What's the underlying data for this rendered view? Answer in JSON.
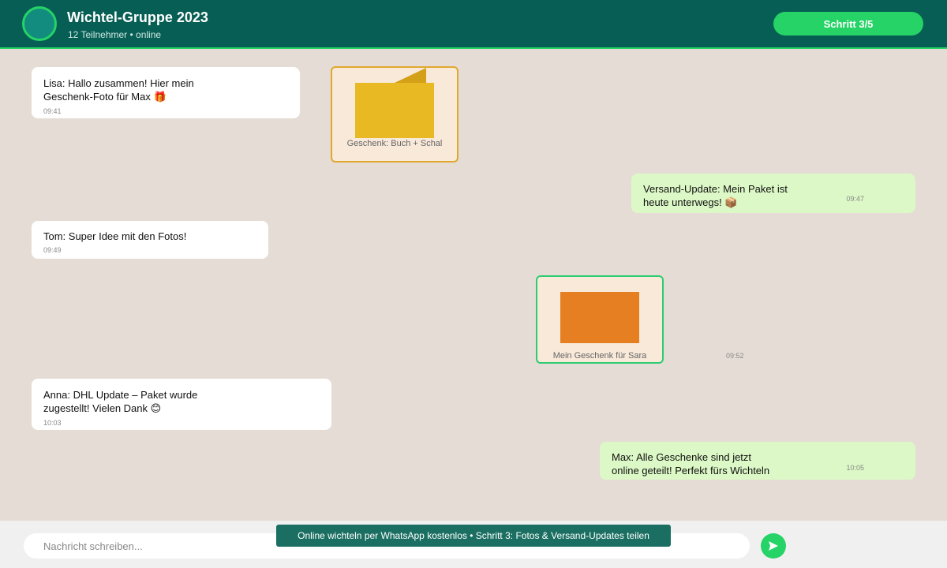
{
  "header": {
    "title": "Wichtel-Gruppe 2023",
    "subtitle": "12 Teilnehmer • online",
    "step_label": "Schritt 3/5"
  },
  "messages": [
    {
      "text": "Lisa: Hallo zusammen! Hier mein\nGeschenk-Foto für Max 🎁",
      "time": "09:41"
    },
    {
      "caption": "Geschenk: Buch + Schal",
      "color": "#e8b923"
    },
    {
      "text": "Versand-Update: Mein Paket ist\nheute unterwegs! 📦",
      "time": "09:47"
    },
    {
      "text": "Tom: Super Idee mit den Fotos!",
      "time": "09:49"
    },
    {
      "caption": "Mein Geschenk für Sara",
      "time": "09:52",
      "color": "#e67e22"
    },
    {
      "text": "Anna: DHL Update – Paket wurde\nzugestellt! Vielen Dank 😊",
      "time": "10:03"
    },
    {
      "text": "Max: Alle Geschenke sind jetzt\nonline geteilt! Perfekt fürs Wichteln",
      "time": "10:05"
    }
  ],
  "composer": {
    "placeholder": "Nachricht schreiben...",
    "send_icon": "send-arrow-icon"
  },
  "banner": {
    "text": "Online wichteln per WhatsApp kostenlos • Schritt 3: Fotos & Versand-Updates teilen"
  },
  "colors": {
    "header": "#075e54",
    "accent": "#25d366",
    "incoming_bubble": "#ffffff",
    "outgoing_bubble": "#dcf8c6",
    "chat_background": "#e5ddd5"
  }
}
